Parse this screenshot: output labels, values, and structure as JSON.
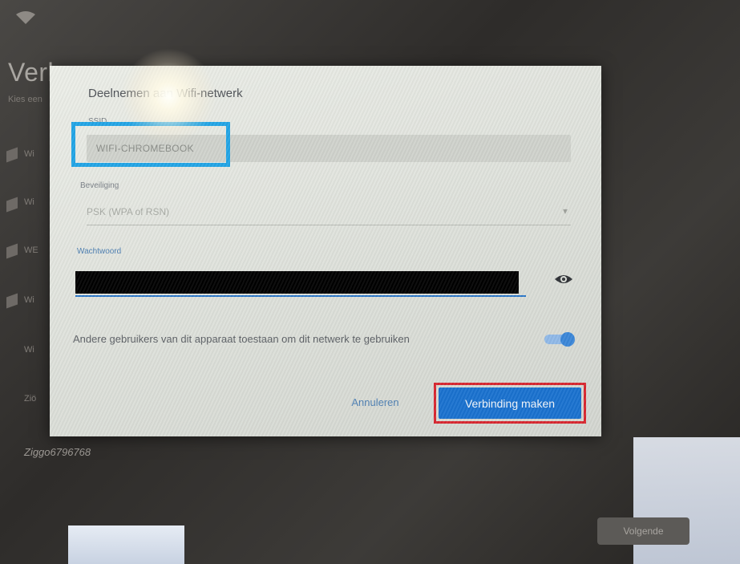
{
  "background": {
    "title": "Verb",
    "subtitle": "Kies een",
    "network_name": "Ziggo6796768",
    "next_button": "Volgende",
    "side_items": [
      "Wi",
      "Wi",
      "WE",
      "Wi",
      "Wi",
      "Ziö"
    ]
  },
  "dialog": {
    "title": "Deelnemen aan Wifi-netwerk",
    "ssid": {
      "label": "SSID",
      "value": "WIFI-CHROMEBOOK"
    },
    "security": {
      "label": "Beveiliging",
      "value": "PSK (WPA of RSN)"
    },
    "password": {
      "label": "Wachtwoord",
      "value": ""
    },
    "share_toggle": {
      "label": "Andere gebruikers van dit apparaat toestaan om dit netwerk te gebruiken",
      "enabled": true
    },
    "cancel_button": "Annuleren",
    "connect_button": "Verbinding maken"
  },
  "colors": {
    "ssid_highlight": "#22a5e6",
    "connect_highlight": "#d8262f",
    "primary": "#1a72cf"
  },
  "icons": {
    "wifi": "wifi-icon",
    "eye": "eye-icon",
    "chevron": "chevron-down-icon"
  }
}
